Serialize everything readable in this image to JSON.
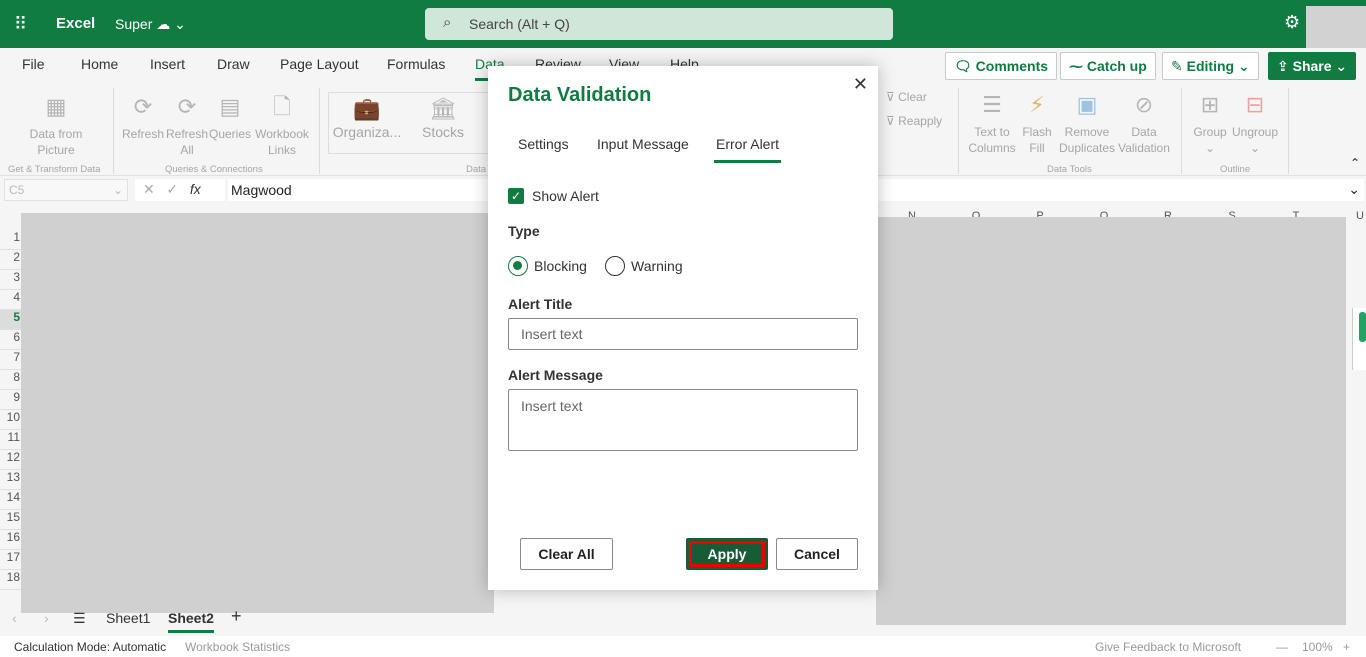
{
  "app": {
    "name": "Excel",
    "doc": "Super",
    "search_placeholder": "Search (Alt + Q)"
  },
  "tabs": [
    "File",
    "Home",
    "Insert",
    "Draw",
    "Page Layout",
    "Formulas",
    "Data",
    "Review",
    "View",
    "Help"
  ],
  "active_tab": "Data",
  "top_buttons": {
    "comments": "Comments",
    "catchup": "Catch up",
    "editing": "Editing",
    "share": "Share"
  },
  "ribbon": {
    "items": [
      {
        "label": "Data from Picture"
      },
      {
        "label": "Refresh"
      },
      {
        "label": "Refresh All"
      },
      {
        "label": "Queries"
      },
      {
        "label": "Workbook Links"
      },
      {
        "label": "Organiza..."
      },
      {
        "label": "Stocks"
      },
      {
        "label": "Clear"
      },
      {
        "label": "Reapply"
      },
      {
        "label": "Text to Columns"
      },
      {
        "label": "Flash Fill"
      },
      {
        "label": "Remove Duplicates"
      },
      {
        "label": "Data Validation"
      },
      {
        "label": "Group"
      },
      {
        "label": "Ungroup"
      }
    ],
    "groups": [
      "Get & Transform Data",
      "Queries & Connections",
      "Data",
      "Data Tools",
      "Outline"
    ]
  },
  "formula_bar": {
    "cell": "C5",
    "value": "Magwood",
    "fx": "fx"
  },
  "columns_right": [
    "N",
    "O",
    "P",
    "Q",
    "R",
    "S",
    "T",
    "U"
  ],
  "rows": [
    "1",
    "2",
    "3",
    "4",
    "5",
    "6",
    "7",
    "8",
    "9",
    "10",
    "11",
    "12",
    "13",
    "14",
    "15",
    "16",
    "17",
    "18"
  ],
  "selected_row": "5",
  "sheets": [
    "Sheet1",
    "Sheet2"
  ],
  "active_sheet": "Sheet2",
  "status": {
    "calc": "Calculation Mode: Automatic",
    "stats": "Workbook Statistics",
    "feedback": "Give Feedback to Microsoft",
    "zoom": "100%"
  },
  "dialog": {
    "title": "Data Validation",
    "tabs": [
      "Settings",
      "Input Message",
      "Error Alert"
    ],
    "active_tab": "Error Alert",
    "show_alert_label": "Show Alert",
    "show_alert": true,
    "type_label": "Type",
    "type_options": [
      "Blocking",
      "Warning"
    ],
    "type_selected": "Blocking",
    "alert_title_label": "Alert Title",
    "alert_title_placeholder": "Insert text",
    "alert_message_label": "Alert Message",
    "alert_message_placeholder": "Insert text",
    "clear_all": "Clear All",
    "apply": "Apply",
    "cancel": "Cancel"
  },
  "colors": {
    "brand": "#107c41",
    "apply_highlight": "#e00000"
  }
}
